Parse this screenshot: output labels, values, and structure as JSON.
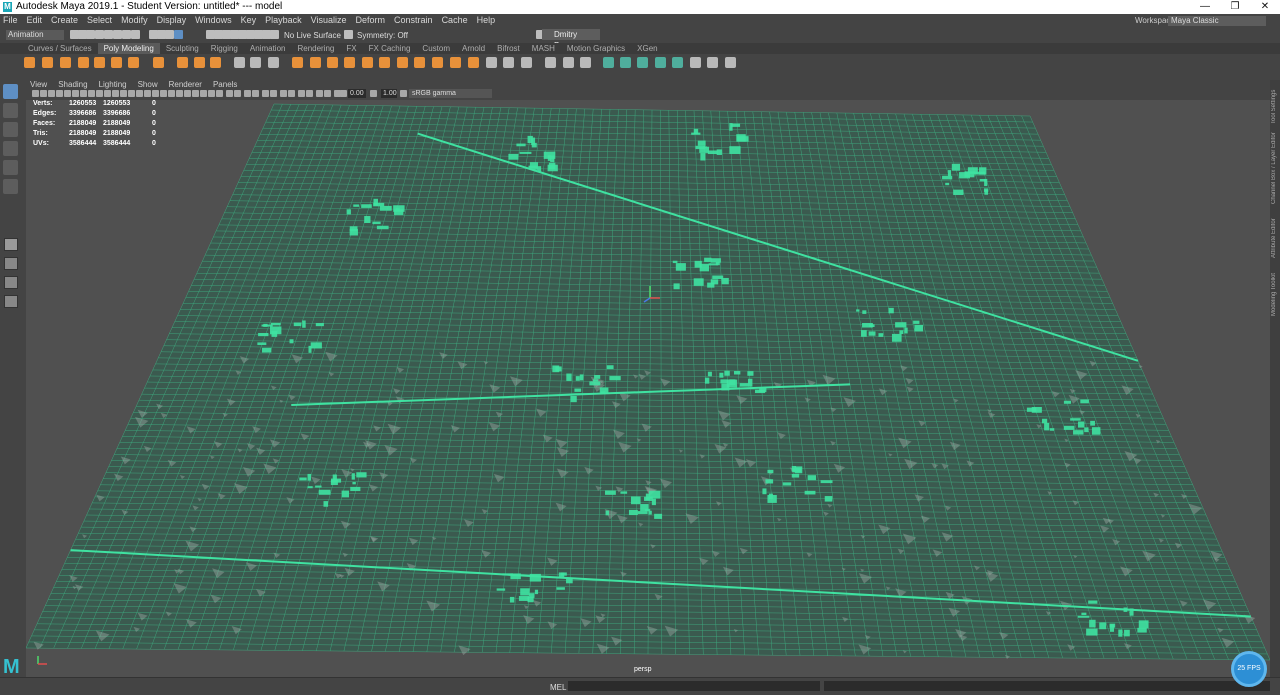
{
  "window": {
    "title": "Autodesk Maya 2019.1 - Student Version: untitled*   ---   model",
    "logo_letter": "M",
    "minimize": "—",
    "maximize": "❐",
    "close": "✕"
  },
  "menubar": {
    "items": [
      "File",
      "Edit",
      "Create",
      "Select",
      "Modify",
      "Display",
      "Windows",
      "Key",
      "Playback",
      "Visualize",
      "Deform",
      "Constrain",
      "Cache",
      "Help"
    ],
    "workspace_label": "Workspace :",
    "workspace_value": "Maya Classic"
  },
  "statusline": {
    "mode": "Animation",
    "live_surface": "No Live Surface",
    "symmetry": "Symmetry: Off",
    "user": "Dmitry Popo..."
  },
  "shelf": {
    "tabs": [
      "Curves / Surfaces",
      "Poly Modeling",
      "Sculpting",
      "Rigging",
      "Animation",
      "Rendering",
      "FX",
      "FX Caching",
      "Custom",
      "Arnold",
      "Bifrost",
      "MASH",
      "Motion Graphics",
      "XGen"
    ],
    "active_tab": "Poly Modeling"
  },
  "panel": {
    "menu": [
      "View",
      "Shading",
      "Lighting",
      "Show",
      "Renderer",
      "Panels"
    ],
    "exposure": "0.00",
    "gamma": "1.00",
    "color_space": "sRGB gamma"
  },
  "hud": {
    "rows": [
      {
        "label": "Verts:",
        "a": "1260553",
        "b": "1260553",
        "c": "0"
      },
      {
        "label": "Edges:",
        "a": "3396686",
        "b": "3396686",
        "c": "0"
      },
      {
        "label": "Faces:",
        "a": "2188049",
        "b": "2188049",
        "c": "0"
      },
      {
        "label": "Tris:",
        "a": "2188049",
        "b": "2188049",
        "c": "0"
      },
      {
        "label": "UVs:",
        "a": "3586444",
        "b": "3586444",
        "c": "0"
      }
    ],
    "camera": "persp"
  },
  "right_tabs": [
    "Tool Settings",
    "Channel Box / Layer Editor",
    "Attribute Editor",
    "Modeling Toolkit"
  ],
  "cmdline": {
    "label": "MEL"
  },
  "colors": {
    "wireframe": "#3fe2a1",
    "viewport_bg": "#505050",
    "ui_bg": "#444444",
    "accent_tool": "#5e8fc4"
  },
  "fps_badge": "25 FPS"
}
